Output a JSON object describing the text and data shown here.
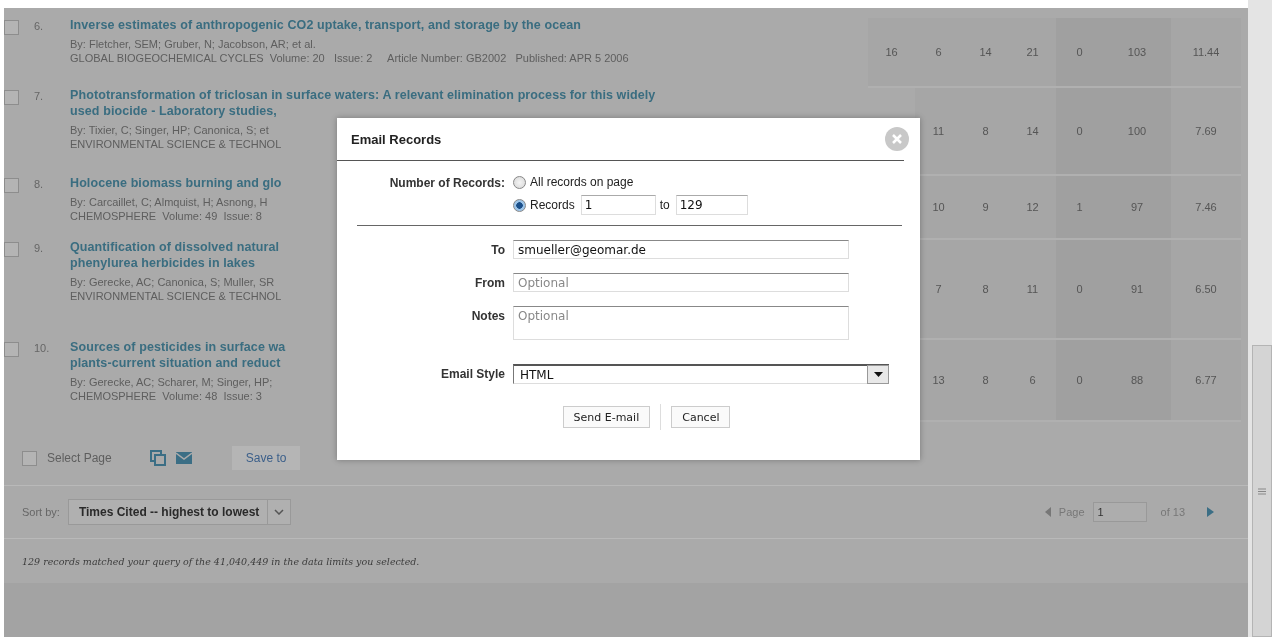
{
  "records": [
    {
      "number": "6.",
      "selected": false,
      "title": [
        "Inverse estimates of anthropogenic CO2 uptake, transport, and storage by the ocean"
      ],
      "authors": "By: Fletcher, SEM; Gruber, N; Jacobson, AR; et al.",
      "source": "GLOBAL BIOGEOCHEMICAL CYCLES  Volume: 20   Issue: 2     Article Number: GB2002   Published: APR 5 2006",
      "counts": [
        "16",
        "6",
        "14",
        "21",
        "0",
        "103",
        "11.44"
      ]
    },
    {
      "number": "7.",
      "selected": false,
      "title": [
        "Phototransformation of triclosan in surface waters: A relevant elimination process for this widely",
        "used biocide - Laboratory studies,"
      ],
      "authors": "By: Tixier, C; Singer, HP; Canonica, S; et",
      "source": "ENVIRONMENTAL SCIENCE & TECHNOL",
      "counts": [
        "11",
        "8",
        "14",
        "0",
        "100",
        "7.69"
      ]
    },
    {
      "number": "8.",
      "selected": false,
      "title": [
        "Holocene biomass burning and glo"
      ],
      "authors": "By: Carcaillet, C; Almquist, H; Asnong, H",
      "source": "CHEMOSPHERE  Volume: 49  Issue: 8",
      "counts": [
        "10",
        "9",
        "12",
        "1",
        "97",
        "7.46"
      ]
    },
    {
      "number": "9.",
      "selected": false,
      "title": [
        "Quantification of dissolved natural",
        "phenylurea herbicides in lakes"
      ],
      "authors": "By: Gerecke, AC; Canonica, S; Muller, SR",
      "source": "ENVIRONMENTAL SCIENCE & TECHNOL",
      "counts": [
        "7",
        "8",
        "11",
        "0",
        "91",
        "6.50"
      ]
    },
    {
      "number": "10.",
      "selected": false,
      "title": [
        "Sources of pesticides in surface wa",
        "plants-current situation and reduct"
      ],
      "authors": "By: Gerecke, AC; Scharer, M; Singer, HP;",
      "source": "CHEMOSPHERE  Volume: 48  Issue: 3",
      "counts": [
        "13",
        "8",
        "6",
        "0",
        "88",
        "6.77"
      ]
    }
  ],
  "toolbar": {
    "select_page": {
      "label": "Select Page",
      "checked": false
    },
    "save_button": "Save to"
  },
  "sort": {
    "label": "Sort by:",
    "value": "Times Cited -- highest to lowest"
  },
  "pagination": {
    "label": "Page",
    "value": "1",
    "of": "of 13"
  },
  "footer": "129 records matched your query of the 41,040,449 in the data limits you selected.",
  "dialog": {
    "title": "Email Records",
    "records_label": "Number of Records:",
    "options": [
      {
        "label": "All records on page",
        "selected": false
      },
      {
        "label": "Records",
        "selected": true
      }
    ],
    "range": {
      "from": "1",
      "to_label": "to",
      "to": "129"
    },
    "fields": [
      {
        "kind": "input",
        "label": "To",
        "value": "smueller@geomar.de"
      },
      {
        "kind": "input",
        "label": "From",
        "placeholder": "Optional"
      },
      {
        "kind": "textarea",
        "label": "Notes",
        "placeholder": "Optional"
      },
      {
        "kind": "select",
        "label": "Email Style",
        "value": "HTML"
      }
    ],
    "buttons": [
      "Send E-mail",
      "Cancel"
    ]
  }
}
